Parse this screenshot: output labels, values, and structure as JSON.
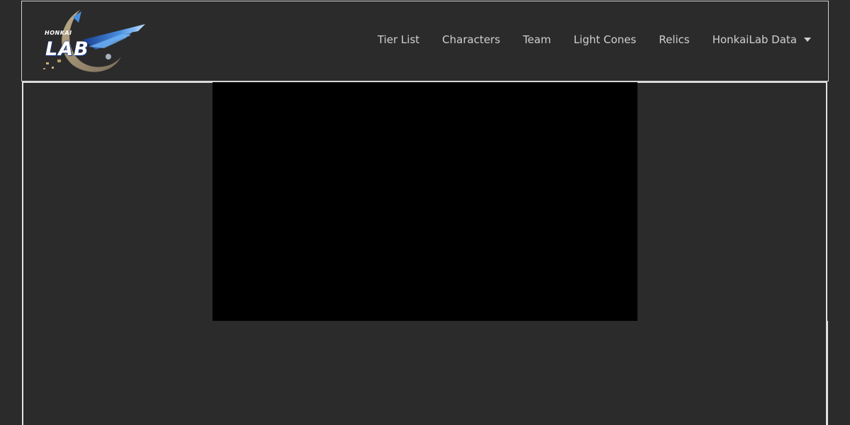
{
  "logo": {
    "sub": "HONKAI",
    "word": "LAB"
  },
  "nav": {
    "items": [
      {
        "label": "Tier List"
      },
      {
        "label": "Characters"
      },
      {
        "label": "Team"
      },
      {
        "label": "Light Cones"
      },
      {
        "label": "Relics"
      }
    ],
    "dropdown": {
      "label": "HonkaiLab Data",
      "icon": "caret-down-icon"
    }
  },
  "colors": {
    "background": "#2b2b2b",
    "nav_text": "#d0d0d0",
    "border": "#e0e0e0",
    "video": "#000000"
  }
}
